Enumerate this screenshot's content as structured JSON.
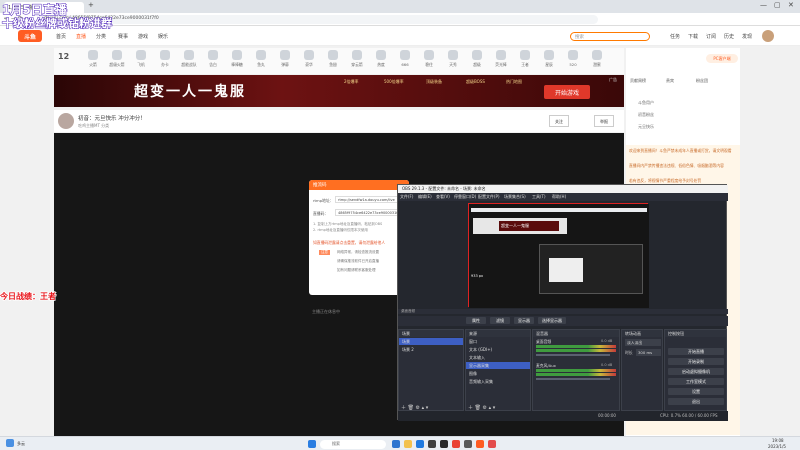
{
  "overlay": {
    "line1": "1月5日直播",
    "line2": "十级粉丝牌或钻粉进群",
    "left_text": "今日战绩：王者"
  },
  "browser": {
    "tab_label": "1月5日直播",
    "new_tab": "+",
    "address": "douyu.com/ 48655f9754ce6422e73ce9000031f7f0",
    "controls": [
      "—",
      "▢",
      "✕"
    ]
  },
  "douyu": {
    "logo": "斗鱼",
    "nav": [
      "首页",
      "直播",
      "分类",
      "赛事",
      "游戏",
      "娱乐"
    ],
    "search_placeholder": "搜索",
    "header_right": [
      "任务",
      "下载",
      "订阅",
      "历史",
      "发现"
    ],
    "gift_count": "12",
    "gifts": [
      "火箭",
      "超级火箭",
      "飞机",
      "办卡",
      "超能战队",
      "告白",
      "棒棒糖",
      "鱼丸",
      "弹幕",
      "豪华",
      "鱼翅",
      "穿云箭",
      "热度",
      "666",
      "稳住",
      "天秀",
      "超级",
      "荧光棒",
      "王者",
      "星辰",
      "520",
      "甜蜜"
    ],
    "banner_title": "超变一人一鬼服",
    "banner_items": [
      "2倍爆率",
      "500倍爆率",
      "顶级装备",
      "超级BOSS",
      "热门地图"
    ],
    "banner_button": "开始游戏",
    "banner_ad": "广告",
    "room_title": "初音：元旦快乐 冲分冲分！",
    "room_sub": "吃鸡主播MT 分类",
    "room_btn1": "关注",
    "room_btn2": "举报",
    "stream_caption": "主播正在休息中",
    "right_top": "PC客户端",
    "rank_tabs": [
      "贡献周榜",
      "贵宾",
      "粉丝团"
    ],
    "users": [
      "斗鱼用户",
      "初音粉丝",
      "元旦快乐"
    ],
    "chat_lines": [
      "欢迎来到直播间！斗鱼严禁未成年人直播或打赏，请文明观看",
      "直播间内严禁传播违法违规、低俗色情、吸烟酗酒等内容",
      "若有违反，将视情节严重程度给予封号处罚"
    ]
  },
  "modal": {
    "title": "推流码",
    "rtmp_label": "rtmp地址：",
    "rtmp_value": "rtmp://sendfw1a.douyu.com/live",
    "key_label": "直播码：",
    "key_value": "4865f9754ce6422e73ce9000031f7f0",
    "tips": [
      "1. 复制上方rtmp地址及直播码，粘贴到OBS",
      "2. rtmp地址及直播码仅限本次使用"
    ],
    "warn": "如直播码泄露请点击重置，请勿泄露给他人",
    "tag": "注意",
    "lines": [
      "网络异常，请检查推流设置",
      "请确保推流软件已开启直播",
      "如有问题请联系客服处理"
    ]
  },
  "obs": {
    "title": "OBS 29.1.3 - 配置文件: 未命名 - 场景: 未命名",
    "menu": [
      "文件(F)",
      "编辑(E)",
      "查看(V)",
      "停靠窗口(D)",
      "配置文件(P)",
      "场景集合(S)",
      "工具(T)",
      "帮助(H)"
    ],
    "preview_label": "933 px",
    "bar_label": "桌面音频",
    "toolbar": [
      "属性",
      "滤镜",
      "显示器",
      "选择显示器"
    ],
    "docks": [
      "场景",
      "来源",
      "混音器",
      "转场动画",
      "控制按钮"
    ],
    "scenes": [
      "场景",
      "场景 2"
    ],
    "sources": [
      "窗口",
      "文本 (GDI+)",
      "文本输入",
      "显示器采集",
      "图像",
      "音频输入采集"
    ],
    "mixer": [
      {
        "name": "桌面音频",
        "db": "0.0 dB"
      },
      {
        "name": "麦克风/Aux",
        "db": "0.0 dB"
      }
    ],
    "transition": {
      "type": "淡入淡出",
      "duration_label": "时长",
      "duration": "300 ms"
    },
    "controls": [
      "开始直播",
      "开始录制",
      "启动虚拟摄像机",
      "工作室模式",
      "设置",
      "退出"
    ],
    "status": "CPU: 0.7%   60.00 / 60.00 FPS",
    "time": "00:00:00"
  },
  "taskbar": {
    "weather": "多云",
    "search": "搜索",
    "time": "19:08",
    "date": "2023/1/5"
  }
}
